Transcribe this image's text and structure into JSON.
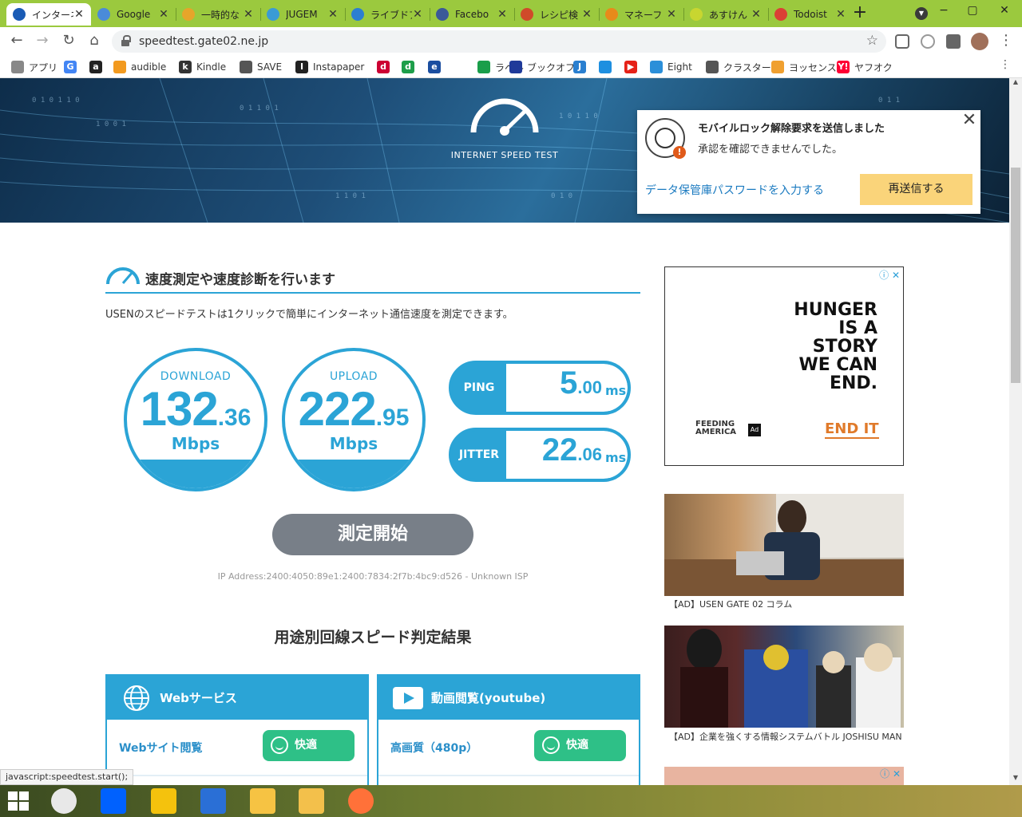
{
  "tabs": [
    {
      "title": "インターネ",
      "color": "#1a5bb5",
      "active": true
    },
    {
      "title": "Google",
      "color": "#4a8bd8"
    },
    {
      "title": "一時的な",
      "color": "#e6a52a"
    },
    {
      "title": "JUGEM",
      "color": "#3a9bd5"
    },
    {
      "title": "ライブドア",
      "color": "#2c7fd0"
    },
    {
      "title": "Facebo",
      "color": "#3b5998"
    },
    {
      "title": "レシピ検",
      "color": "#d04a2a"
    },
    {
      "title": "マネーフ",
      "color": "#e88a1a"
    },
    {
      "title": "あすけん",
      "color": "#c8d630"
    },
    {
      "title": "Todoist",
      "color": "#db4035"
    }
  ],
  "tab_close_glyph": "✕",
  "newtab_glyph": "+",
  "window_buttons": [
    "−",
    "▢",
    "✕"
  ],
  "toolbar": {
    "back": "←",
    "forward": "→",
    "reload": "↻",
    "home": "⌂",
    "url": "speedtest.gate02.ne.jp",
    "star": "☆"
  },
  "bookmarks": [
    {
      "label": "アプリ",
      "icon": "apps-icon",
      "color": "#888"
    },
    {
      "label": "",
      "icon": "google-icon",
      "color": "#4285f4",
      "glyph": "G"
    },
    {
      "label": "",
      "icon": "amazon-icon",
      "color": "#222",
      "glyph": "a"
    },
    {
      "label": "audible",
      "icon": "audible-icon",
      "color": "#f29a1f"
    },
    {
      "label": "Kindle",
      "icon": "kindle-icon",
      "color": "#333",
      "glyph": "k"
    },
    {
      "label": "SAVE",
      "icon": "globe-icon",
      "color": "#555"
    },
    {
      "label": "Instapaper",
      "icon": "instapaper-icon",
      "color": "#222",
      "glyph": "I"
    },
    {
      "label": "",
      "icon": "d-tv-icon",
      "color": "#cc0033",
      "glyph": "d"
    },
    {
      "label": "",
      "icon": "d-magazine-icon",
      "color": "#1e9e4a",
      "glyph": "d"
    },
    {
      "label": "",
      "icon": "ehon-icon",
      "color": "#1b4ea0",
      "glyph": "e"
    },
    {
      "label": "ラベル",
      "icon": "label-icon",
      "color": "#1a9e4a"
    },
    {
      "label": "ブックオフ",
      "icon": "bookoff-icon",
      "color": "#1f3a99"
    },
    {
      "label": "",
      "icon": "j-icon",
      "color": "#2a7fd0",
      "glyph": "J"
    },
    {
      "label": "",
      "icon": "pen-icon",
      "color": "#1e8fe0"
    },
    {
      "label": "",
      "icon": "youtube-icon",
      "color": "#e62117",
      "glyph": "▶"
    },
    {
      "label": "Eight",
      "icon": "eight-icon",
      "color": "#2b8fd9"
    },
    {
      "label": "クラスター",
      "icon": "globe-icon",
      "color": "#555"
    },
    {
      "label": "ヨッセンス",
      "icon": "yossense-icon",
      "color": "#f0a030"
    },
    {
      "label": "ヤフオク",
      "icon": "yahoo-icon",
      "color": "#ff0033",
      "glyph": "Y!"
    }
  ],
  "bookmarks_more": "⋮",
  "hero": {
    "caption": "INTERNET SPEED TEST"
  },
  "notification": {
    "title": "モバイルロック解除要求を送信しました",
    "subtitle": "承認を確認できませんでした。",
    "link": "データ保管庫パスワードを入力する",
    "button": "再送信する",
    "close": "✕",
    "badge": "!"
  },
  "section": {
    "title": "速度測定や速度診断を行います",
    "description": "USENのスピードテストは1クリックで簡単にインターネット通信速度を測定できます。"
  },
  "download": {
    "label": "DOWNLOAD",
    "int": "132",
    "dec": ".36",
    "unit": "Mbps"
  },
  "upload": {
    "label": "UPLOAD",
    "int": "222",
    "dec": ".95",
    "unit": "Mbps"
  },
  "ping": {
    "label": "PING",
    "int": "5",
    "dec": ".00",
    "unit": "ms"
  },
  "jitter": {
    "label": "JITTER",
    "int": "22",
    "dec": ".06",
    "unit": "ms"
  },
  "start_button": "測定開始",
  "ip_line": "IP Address:2400:4050:89e1:2400:7834:2f7b:4bc9:d526 - Unknown ISP",
  "results_title": "用途別回線スピード判定結果",
  "cards": [
    {
      "title": "Webサービス",
      "row_label": "Webサイト閲覧",
      "status": "快適"
    },
    {
      "title": "動画閲覧(youtube)",
      "row_label": "高画質（480p）",
      "status": "快適"
    }
  ],
  "ad1": {
    "choices": "ⓘ ✕",
    "headline": "HUNGER IS A STORY WE CAN END.",
    "brand": "FEEDING AMERICA",
    "council": "Ad",
    "cta": "END IT"
  },
  "ad2_caption": "【AD】USEN GATE 02 コラム",
  "ad3_caption": "【AD】企業を強くする情報システムバトル JOSHISU MAN",
  "ad4_choices": "ⓘ ✕",
  "status_bar": "javascript:speedtest.start();",
  "taskbar": [
    {
      "name": "chrome",
      "color": "#e8e8e8"
    },
    {
      "name": "dropbox",
      "color": "#0061fe"
    },
    {
      "name": "norton",
      "color": "#f4c20d"
    },
    {
      "name": "thunderbird",
      "color": "#2a6fd6"
    },
    {
      "name": "keep",
      "color": "#f6c343"
    },
    {
      "name": "file-explorer",
      "color": "#f3c04b"
    },
    {
      "name": "firefox",
      "color": "#ff7139"
    }
  ]
}
